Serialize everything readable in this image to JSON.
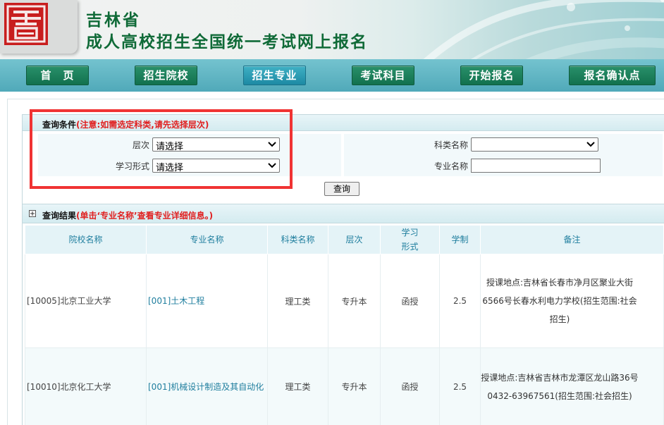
{
  "header": {
    "province": "吉林省",
    "title": "成人高校招生全国统一考试网上报名"
  },
  "nav": {
    "items": [
      {
        "label": "首　页",
        "active": false
      },
      {
        "label": "招生院校",
        "active": false
      },
      {
        "label": "招生专业",
        "active": true
      },
      {
        "label": "考试科目",
        "active": false
      },
      {
        "label": "开始报名",
        "active": false
      },
      {
        "label": "报名确认点",
        "active": false
      }
    ]
  },
  "query": {
    "title": "查询条件",
    "note": "(注意:如需选定科类,请先选择层次)",
    "level_label": "层次",
    "level_value": "请选择",
    "study_form_label": "学习形式",
    "study_form_value": "请选择",
    "category_label": "科类名称",
    "category_value": "",
    "major_label": "专业名称",
    "major_value": "",
    "search_label": "查询"
  },
  "results": {
    "title": "查询结果",
    "note": "(单击‘专业名称’查看专业详细信息。)",
    "columns": [
      "院校名称",
      "专业名称",
      "科类名称",
      "层次",
      "学习\n形式",
      "学制",
      "备注"
    ],
    "rows": [
      {
        "school": "[10005]北京工业大学",
        "major": "[001]土木工程",
        "category": "理工类",
        "level": "专升本",
        "form": "函授",
        "years": "2.5",
        "remark": "授课地点:吉林省长春市净月区聚业大街6566号长春水利电力学校(招生范围:社会招生)"
      },
      {
        "school": "[10010]北京化工大学",
        "major": "[001]机械设计制造及其自动化",
        "category": "理工类",
        "level": "专升本",
        "form": "函授",
        "years": "2.5",
        "remark": "授课地点:吉林省吉林市龙潭区龙山路36号0432-63967561(招生范围:社会招生)"
      }
    ]
  },
  "colors": {
    "title_green": "#0f6a37",
    "nav_teal": "#50a9b9",
    "accent_red": "#e02020",
    "link_teal": "#1f7e9e"
  }
}
